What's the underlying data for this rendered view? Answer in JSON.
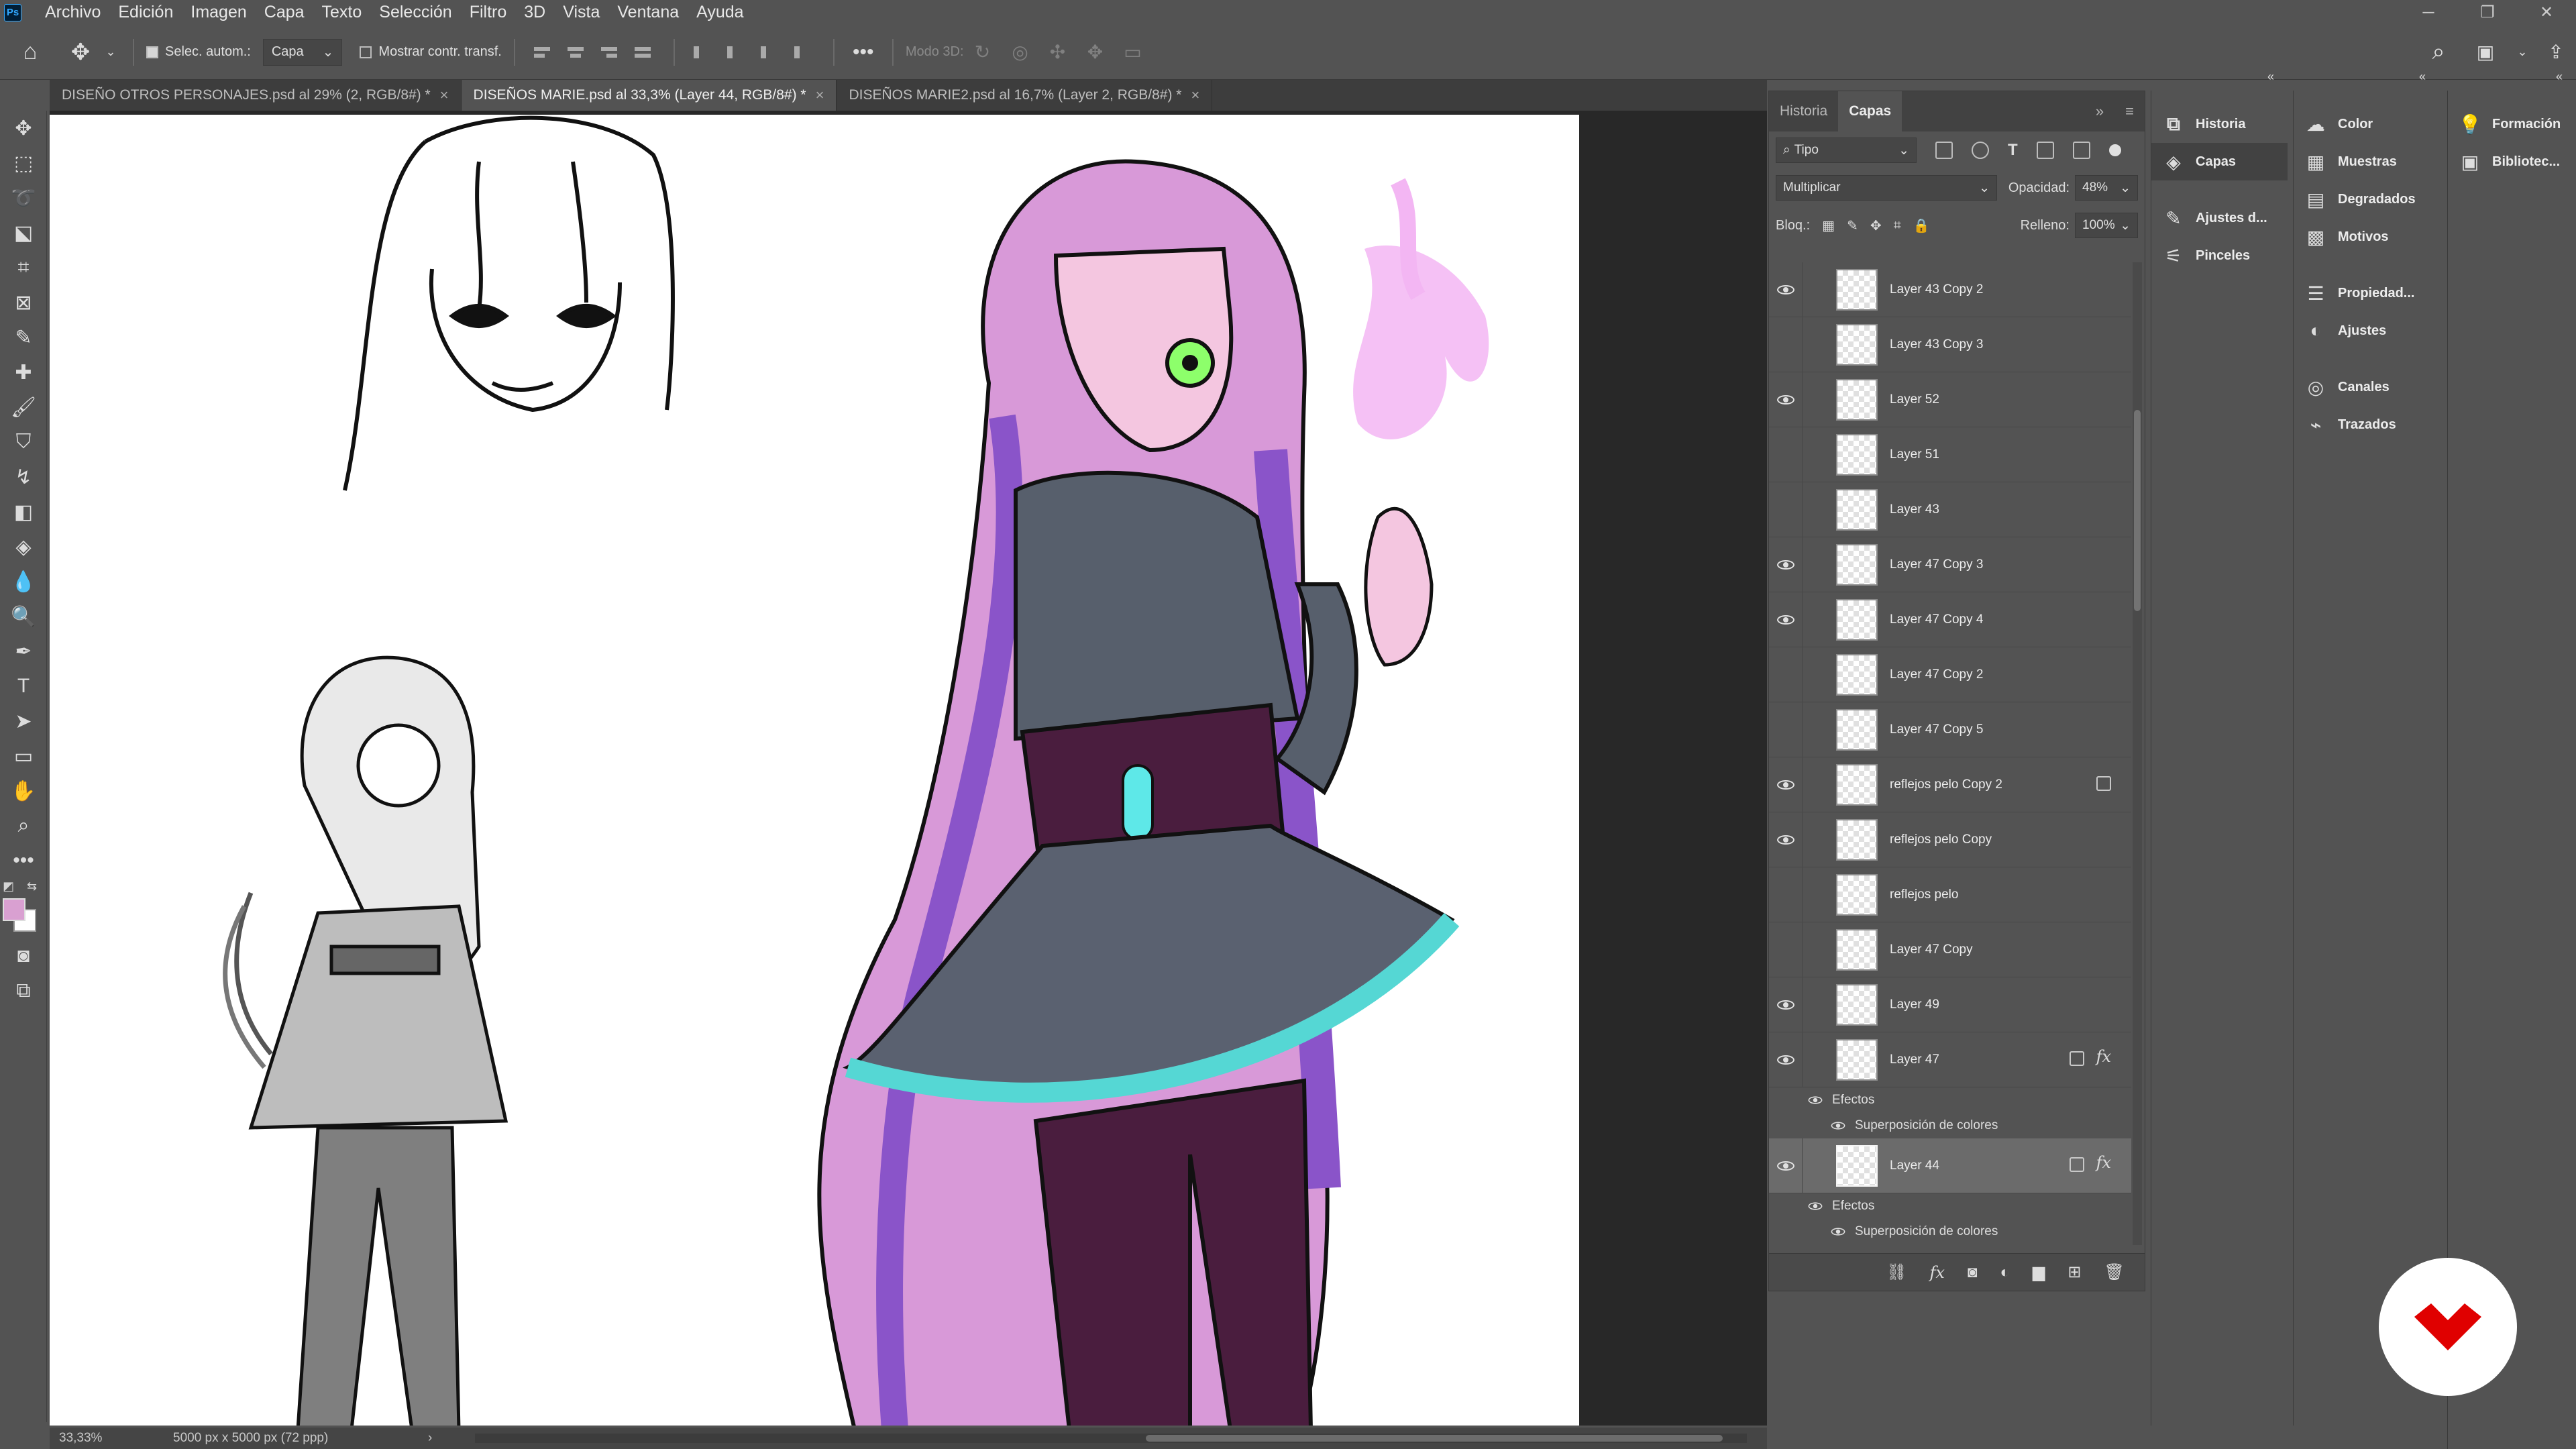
{
  "menubar": {
    "logo": "Ps",
    "items": [
      "Archivo",
      "Edición",
      "Imagen",
      "Capa",
      "Texto",
      "Selección",
      "Filtro",
      "3D",
      "Vista",
      "Ventana",
      "Ayuda"
    ]
  },
  "options": {
    "auto_select_label": "Selec. autom.:",
    "auto_select_target": "Capa",
    "transform_label": "Mostrar contr. transf.",
    "mode3d_label": "Modo 3D:"
  },
  "tabs": [
    {
      "label": "DISEÑO OTROS PERSONAJES.psd al 29% (2, RGB/8#) *",
      "close": "×"
    },
    {
      "label": "DISEÑOS MARIE.psd al 33,3% (Layer 44, RGB/8#) *",
      "close": "×"
    },
    {
      "label": "DISEÑOS MARIE2.psd al 16,7% (Layer 2, RGB/8#) *",
      "close": "×"
    }
  ],
  "status": {
    "zoom": "33,33%",
    "doc_size": "5000 px x 5000 px (72 ppp)",
    "arrow": "›"
  },
  "layers_panel": {
    "tabs": [
      "Historia",
      "Capas"
    ],
    "filter_kind": "Tipo",
    "blend_mode": "Multiplicar",
    "opacity_label": "Opacidad:",
    "opacity_value": "48%",
    "lock_label": "Bloq.:",
    "fill_label": "Relleno:",
    "fill_value": "100%",
    "layers": [
      {
        "name": "Layer 43 Copy 2",
        "visible": true
      },
      {
        "name": "Layer 43 Copy 3",
        "visible": false
      },
      {
        "name": "Layer 52",
        "visible": true
      },
      {
        "name": "Layer 51",
        "visible": false
      },
      {
        "name": "Layer 43",
        "visible": false
      },
      {
        "name": "Layer 47 Copy 3",
        "visible": true
      },
      {
        "name": "Layer 47 Copy 4",
        "visible": true
      },
      {
        "name": "Layer 47 Copy 2",
        "visible": false
      },
      {
        "name": "Layer 47 Copy 5",
        "visible": false
      },
      {
        "name": "reflejos pelo Copy 2",
        "visible": true,
        "linked": true
      },
      {
        "name": "reflejos pelo Copy",
        "visible": true
      },
      {
        "name": "reflejos pelo",
        "visible": false
      },
      {
        "name": "Layer 47 Copy",
        "visible": false
      },
      {
        "name": "Layer 49",
        "visible": true
      }
    ],
    "layer47": {
      "name": "Layer 47",
      "effects": "Efectos",
      "overlay": "Superposición de colores",
      "fx": "fx"
    },
    "layer44": {
      "name": "Layer 44",
      "effects": "Efectos",
      "overlay": "Superposición de colores",
      "fx": "fx"
    }
  },
  "mid_panel": {
    "items": [
      "Historia",
      "Capas",
      "Ajustes d...",
      "Pinceles"
    ]
  },
  "right_panel": {
    "items": [
      "Color",
      "Muestras",
      "Degradados",
      "Motivos",
      "Propiedad...",
      "Ajustes",
      "Canales",
      "Trazados"
    ]
  },
  "far_panel": {
    "items": [
      "Formación",
      "Bibliotec..."
    ]
  },
  "colors": {
    "foreground": "#d9a0d1",
    "background": "#ffffff",
    "brand": "#e00000"
  }
}
